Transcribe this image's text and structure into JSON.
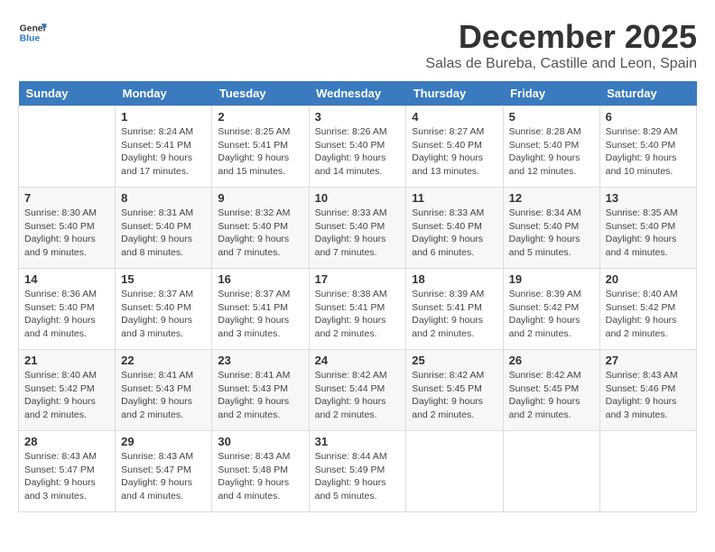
{
  "header": {
    "logo_line1": "General",
    "logo_line2": "Blue",
    "month": "December 2025",
    "location": "Salas de Bureba, Castille and Leon, Spain"
  },
  "weekdays": [
    "Sunday",
    "Monday",
    "Tuesday",
    "Wednesday",
    "Thursday",
    "Friday",
    "Saturday"
  ],
  "weeks": [
    [
      null,
      {
        "day": "1",
        "sunrise": "8:24 AM",
        "sunset": "5:41 PM",
        "daylight": "9 hours and 17 minutes."
      },
      {
        "day": "2",
        "sunrise": "8:25 AM",
        "sunset": "5:41 PM",
        "daylight": "9 hours and 15 minutes."
      },
      {
        "day": "3",
        "sunrise": "8:26 AM",
        "sunset": "5:40 PM",
        "daylight": "9 hours and 14 minutes."
      },
      {
        "day": "4",
        "sunrise": "8:27 AM",
        "sunset": "5:40 PM",
        "daylight": "9 hours and 13 minutes."
      },
      {
        "day": "5",
        "sunrise": "8:28 AM",
        "sunset": "5:40 PM",
        "daylight": "9 hours and 12 minutes."
      },
      {
        "day": "6",
        "sunrise": "8:29 AM",
        "sunset": "5:40 PM",
        "daylight": "9 hours and 10 minutes."
      }
    ],
    [
      {
        "day": "7",
        "sunrise": "8:30 AM",
        "sunset": "5:40 PM",
        "daylight": "9 hours and 9 minutes."
      },
      {
        "day": "8",
        "sunrise": "8:31 AM",
        "sunset": "5:40 PM",
        "daylight": "9 hours and 8 minutes."
      },
      {
        "day": "9",
        "sunrise": "8:32 AM",
        "sunset": "5:40 PM",
        "daylight": "9 hours and 7 minutes."
      },
      {
        "day": "10",
        "sunrise": "8:33 AM",
        "sunset": "5:40 PM",
        "daylight": "9 hours and 7 minutes."
      },
      {
        "day": "11",
        "sunrise": "8:33 AM",
        "sunset": "5:40 PM",
        "daylight": "9 hours and 6 minutes."
      },
      {
        "day": "12",
        "sunrise": "8:34 AM",
        "sunset": "5:40 PM",
        "daylight": "9 hours and 5 minutes."
      },
      {
        "day": "13",
        "sunrise": "8:35 AM",
        "sunset": "5:40 PM",
        "daylight": "9 hours and 4 minutes."
      }
    ],
    [
      {
        "day": "14",
        "sunrise": "8:36 AM",
        "sunset": "5:40 PM",
        "daylight": "9 hours and 4 minutes."
      },
      {
        "day": "15",
        "sunrise": "8:37 AM",
        "sunset": "5:40 PM",
        "daylight": "9 hours and 3 minutes."
      },
      {
        "day": "16",
        "sunrise": "8:37 AM",
        "sunset": "5:41 PM",
        "daylight": "9 hours and 3 minutes."
      },
      {
        "day": "17",
        "sunrise": "8:38 AM",
        "sunset": "5:41 PM",
        "daylight": "9 hours and 2 minutes."
      },
      {
        "day": "18",
        "sunrise": "8:39 AM",
        "sunset": "5:41 PM",
        "daylight": "9 hours and 2 minutes."
      },
      {
        "day": "19",
        "sunrise": "8:39 AM",
        "sunset": "5:42 PM",
        "daylight": "9 hours and 2 minutes."
      },
      {
        "day": "20",
        "sunrise": "8:40 AM",
        "sunset": "5:42 PM",
        "daylight": "9 hours and 2 minutes."
      }
    ],
    [
      {
        "day": "21",
        "sunrise": "8:40 AM",
        "sunset": "5:42 PM",
        "daylight": "9 hours and 2 minutes."
      },
      {
        "day": "22",
        "sunrise": "8:41 AM",
        "sunset": "5:43 PM",
        "daylight": "9 hours and 2 minutes."
      },
      {
        "day": "23",
        "sunrise": "8:41 AM",
        "sunset": "5:43 PM",
        "daylight": "9 hours and 2 minutes."
      },
      {
        "day": "24",
        "sunrise": "8:42 AM",
        "sunset": "5:44 PM",
        "daylight": "9 hours and 2 minutes."
      },
      {
        "day": "25",
        "sunrise": "8:42 AM",
        "sunset": "5:45 PM",
        "daylight": "9 hours and 2 minutes."
      },
      {
        "day": "26",
        "sunrise": "8:42 AM",
        "sunset": "5:45 PM",
        "daylight": "9 hours and 2 minutes."
      },
      {
        "day": "27",
        "sunrise": "8:43 AM",
        "sunset": "5:46 PM",
        "daylight": "9 hours and 3 minutes."
      }
    ],
    [
      {
        "day": "28",
        "sunrise": "8:43 AM",
        "sunset": "5:47 PM",
        "daylight": "9 hours and 3 minutes."
      },
      {
        "day": "29",
        "sunrise": "8:43 AM",
        "sunset": "5:47 PM",
        "daylight": "9 hours and 4 minutes."
      },
      {
        "day": "30",
        "sunrise": "8:43 AM",
        "sunset": "5:48 PM",
        "daylight": "9 hours and 4 minutes."
      },
      {
        "day": "31",
        "sunrise": "8:44 AM",
        "sunset": "5:49 PM",
        "daylight": "9 hours and 5 minutes."
      },
      null,
      null,
      null
    ]
  ]
}
